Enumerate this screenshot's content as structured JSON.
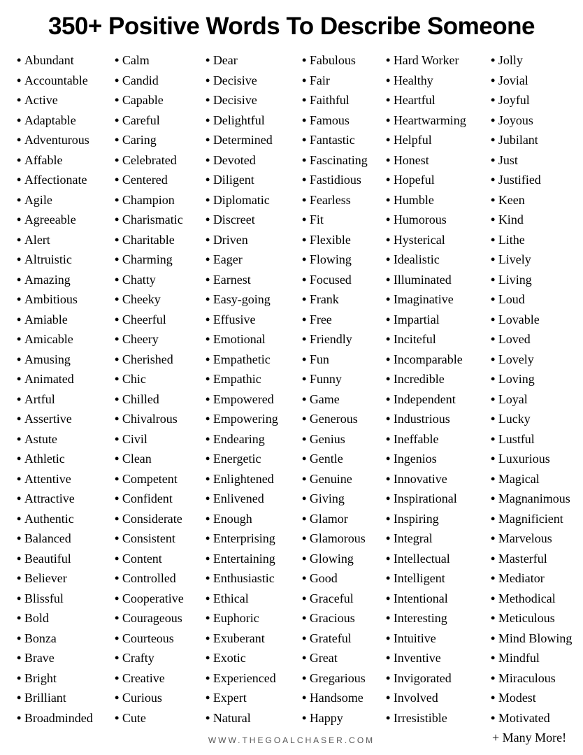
{
  "title": "350+ Positive Words To Describe Someone",
  "footer": "WWW.THEGOALCHASER.COM",
  "more_label": "+ Many More!",
  "columns": [
    [
      "Abundant",
      "Accountable",
      "Active",
      "Adaptable",
      "Adventurous",
      "Affable",
      "Affectionate",
      "Agile",
      "Agreeable",
      "Alert",
      "Altruistic",
      "Amazing",
      "Ambitious",
      "Amiable",
      "Amicable",
      "Amusing",
      "Animated",
      "Artful",
      "Assertive",
      "Astute",
      "Athletic",
      "Attentive",
      "Attractive",
      "Authentic",
      "Balanced",
      "Beautiful",
      "Believer",
      "Blissful",
      "Bold",
      "Bonza",
      "Brave",
      "Bright",
      "Brilliant",
      "Broadminded"
    ],
    [
      "Calm",
      "Candid",
      "Capable",
      "Careful",
      "Caring",
      "Celebrated",
      "Centered",
      "Champion",
      "Charismatic",
      "Charitable",
      "Charming",
      "Chatty",
      "Cheeky",
      "Cheerful",
      "Cheery",
      "Cherished",
      "Chic",
      "Chilled",
      "Chivalrous",
      "Civil",
      "Clean",
      "Competent",
      "Confident",
      "Considerate",
      "Consistent",
      "Content",
      "Controlled",
      "Cooperative",
      "Courageous",
      "Courteous",
      "Crafty",
      "Creative",
      "Curious",
      "Cute"
    ],
    [
      "Dear",
      "Decisive",
      "Decisive",
      "Delightful",
      "Determined",
      "Devoted",
      "Diligent",
      "Diplomatic",
      "Discreet",
      "Driven",
      "Eager",
      "Earnest",
      "Easy-going",
      "Effusive",
      "Emotional",
      "Empathetic",
      "Empathic",
      "Empowered",
      "Empowering",
      "Endearing",
      "Energetic",
      "Enlightened",
      "Enlivened",
      "Enough",
      "Enterprising",
      "Entertaining",
      "Enthusiastic",
      "Ethical",
      "Euphoric",
      "Exuberant",
      "Exotic",
      "Experienced",
      "Expert",
      "Natural"
    ],
    [
      "Fabulous",
      "Fair",
      "Faithful",
      "Famous",
      "Fantastic",
      "Fascinating",
      "Fastidious",
      "Fearless",
      "Fit",
      "Flexible",
      "Flowing",
      "Focused",
      "Frank",
      "Free",
      "Friendly",
      "Fun",
      "Funny",
      "Game",
      "Generous",
      "Genius",
      "Gentle",
      "Genuine",
      "Giving",
      "Glamor",
      "Glamorous",
      "Glowing",
      "Good",
      "Graceful",
      "Gracious",
      "Grateful",
      "Great",
      "Gregarious",
      "Handsome",
      "Happy"
    ],
    [
      "Hard Worker",
      "Healthy",
      "Heartful",
      "Heartwarming",
      "Helpful",
      "Honest",
      "Hopeful",
      "Humble",
      "Humorous",
      "Hysterical",
      "Idealistic",
      "Illuminated",
      "Imaginative",
      "Impartial",
      "Inciteful",
      "Incomparable",
      "Incredible",
      "Independent",
      "Industrious",
      "Ineffable",
      "Ingenios",
      "Innovative",
      "Inspirational",
      "Inspiring",
      "Integral",
      "Intellectual",
      "Intelligent",
      "Intentional",
      "Interesting",
      "Intuitive",
      "Inventive",
      "Invigorated",
      "Involved",
      "Irresistible"
    ],
    [
      "Jolly",
      "Jovial",
      "Joyful",
      "Joyous",
      "Jubilant",
      "Just",
      "Justified",
      "Keen",
      "Kind",
      "Lithe",
      "Lively",
      "Living",
      "Loud",
      "Lovable",
      "Loved",
      "Lovely",
      "Loving",
      "Loyal",
      "Lucky",
      "Lustful",
      "Luxurious",
      "Magical",
      "Magnanimous",
      "Magnificient",
      "Marvelous",
      "Masterful",
      "Mediator",
      "Methodical",
      "Meticulous",
      "Mind Blowing",
      "Mindful",
      "Miraculous",
      "Modest",
      "Motivated"
    ]
  ]
}
